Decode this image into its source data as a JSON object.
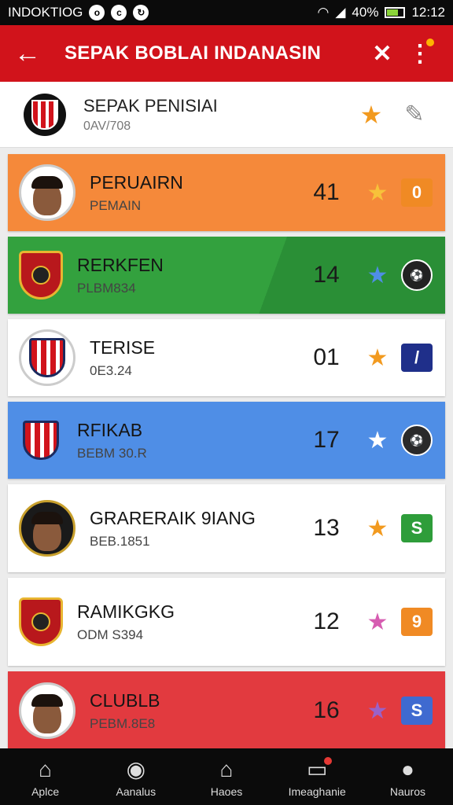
{
  "status": {
    "carrier": "INDOKTIOG",
    "battery": "40%",
    "time": "12:12",
    "icons": [
      "circle-icon",
      "circle-icon",
      "sync-icon",
      "wifi-icon",
      "signal-icon",
      "battery-icon"
    ]
  },
  "appbar": {
    "title": "SEPAK BOBLAI INDANASIN",
    "back_icon": "arrow-left-icon",
    "action_icon": "shuffle-icon",
    "menu_icon": "more-vert-icon"
  },
  "header": {
    "title": "SEPAK PENISIAI",
    "subtitle": "0AV/708",
    "star_icon": "star-icon",
    "tool_icon": "wrench-icon"
  },
  "colors": {
    "appbar": "#d1131b",
    "orange": "#f5893a",
    "green": "#2e9d3a",
    "blue": "#4f8ee6",
    "red": "#e23a3f",
    "white": "#ffffff"
  },
  "rows": [
    {
      "name": "PERUAIRN",
      "sub": "PEMAIN",
      "num": "41",
      "star_color": "#f7c23a",
      "badge": "0",
      "badge_color": "#f08a24",
      "bg": "#f5893a",
      "avatar": "player-photo"
    },
    {
      "name": "RERKFEN",
      "sub": "PLBM834",
      "num": "14",
      "star_color": "#4f8ee6",
      "badge": "",
      "badge_color": "#222222",
      "bg": "#2e9d3a",
      "avatar": "club-crest"
    },
    {
      "name": "TERISE",
      "sub": "0E3.24",
      "num": "01",
      "star_color": "#f29a1f",
      "badge": "/",
      "badge_color": "#1f2f8a",
      "bg": "#ffffff",
      "avatar": "club-crest-stripes"
    },
    {
      "name": "RFIKAB",
      "sub": "BEBM 30.R",
      "num": "17",
      "star_color": "#ffffff",
      "badge": "",
      "badge_color": "#2a2a2a",
      "bg": "#4f8ee6",
      "avatar": "club-crest-stripes"
    },
    {
      "name": "GRARERAIK 9IANG",
      "sub": "BEB.1851",
      "num": "13",
      "star_color": "#f29a1f",
      "badge": "S",
      "badge_color": "#2e9d3a",
      "bg": "#ffffff",
      "avatar": "player-photo"
    },
    {
      "name": "RAMIKGKG",
      "sub": "ODM S394",
      "num": "12",
      "star_color": "#d65cb1",
      "badge": "9",
      "badge_color": "#f08a24",
      "bg": "#ffffff",
      "avatar": "club-crest"
    },
    {
      "name": "CLUBLB",
      "sub": "PEBM.8E8",
      "num": "16",
      "star_color": "#9a62c8",
      "badge": "S",
      "badge_color": "#3f6ad0",
      "bg": "#e23a3f",
      "avatar": "player-photo"
    }
  ],
  "nav": [
    {
      "label": "Aplce",
      "icon": "home-icon"
    },
    {
      "label": "Aanalus",
      "icon": "ball-icon"
    },
    {
      "label": "Haoes",
      "icon": "house-icon"
    },
    {
      "label": "Imeaghanie",
      "icon": "messages-icon"
    },
    {
      "label": "Nauros",
      "icon": "profile-icon"
    }
  ]
}
